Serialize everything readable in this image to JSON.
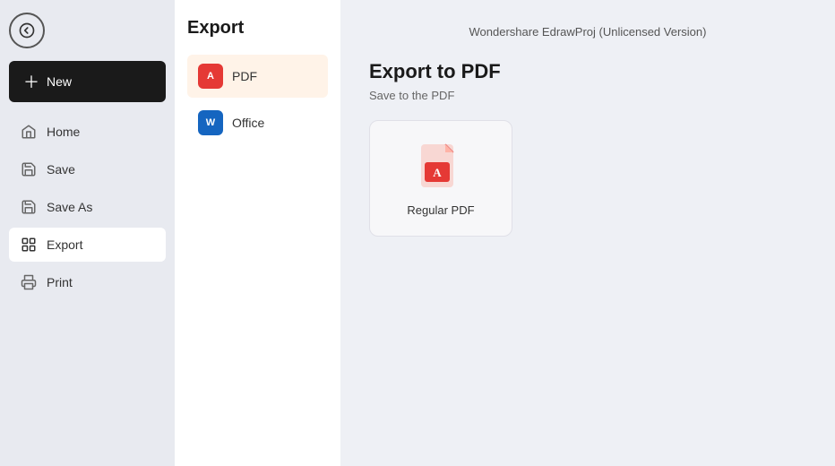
{
  "app": {
    "title": "Wondershare EdrawProj (Unlicensed Version)"
  },
  "sidebar": {
    "new_label": "New",
    "items": [
      {
        "id": "home",
        "label": "Home"
      },
      {
        "id": "save",
        "label": "Save"
      },
      {
        "id": "save-as",
        "label": "Save As"
      },
      {
        "id": "export",
        "label": "Export"
      },
      {
        "id": "print",
        "label": "Print"
      }
    ]
  },
  "middle": {
    "title": "Export",
    "items": [
      {
        "id": "pdf",
        "label": "PDF"
      },
      {
        "id": "office",
        "label": "Office"
      }
    ]
  },
  "main": {
    "heading": "Export to PDF",
    "subtitle": "Save to the PDF",
    "card": {
      "label": "Regular PDF"
    }
  }
}
